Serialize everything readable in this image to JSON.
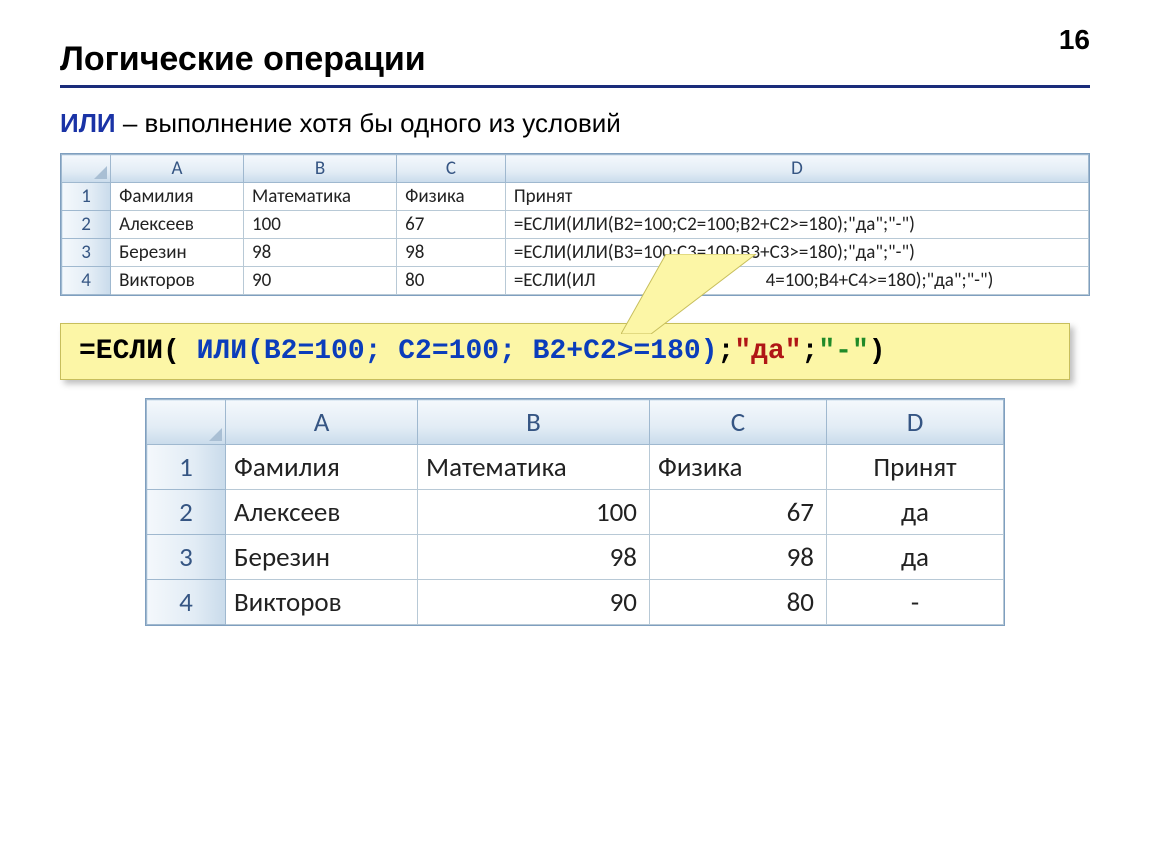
{
  "page_number": "16",
  "title": "Логические операции",
  "subtitle_keyword": "ИЛИ",
  "subtitle_rest": " – выполнение хотя бы одного из условий",
  "table1": {
    "col_headers": [
      "A",
      "B",
      "C",
      "D"
    ],
    "row_headers": [
      "1",
      "2",
      "3",
      "4"
    ],
    "rows": [
      {
        "a": "Фамилия",
        "b": "Математика",
        "c": "Физика",
        "d": "Принят"
      },
      {
        "a": "Алексеев",
        "b": "100",
        "c": "67",
        "d": "=ЕСЛИ(ИЛИ(B2=100;C2=100;B2+C2>=180);\"да\";\"-\")"
      },
      {
        "a": "Березин",
        "b": "98",
        "c": "98",
        "d": "=ЕСЛИ(ИЛИ(B3=100;C3=100;B3+C3>=180);\"да\";\"-\")"
      },
      {
        "a": "Викторов",
        "b": "90",
        "c": "80",
        "d_prefix": "=ЕСЛИ(ИЛ",
        "d_suffix": "4=100;B4+C4>=180);\"да\";\"-\")"
      }
    ]
  },
  "formula": {
    "prefix": "=ЕСЛИ( ",
    "or_part": "ИЛИ(B2=100; C2=100; B2+C2>=180)",
    "mid": ";",
    "yes": "\"да\"",
    "sep": ";",
    "no": "\"-\"",
    "suffix": ")"
  },
  "table2": {
    "col_headers": [
      "A",
      "B",
      "C",
      "D"
    ],
    "row_headers": [
      "1",
      "2",
      "3",
      "4"
    ],
    "rows": [
      {
        "a": "Фамилия",
        "b": "Математика",
        "c": "Физика",
        "d": "Принят"
      },
      {
        "a": "Алексеев",
        "b": "100",
        "c": "67",
        "d": "да"
      },
      {
        "a": "Березин",
        "b": "98",
        "c": "98",
        "d": "да"
      },
      {
        "a": "Викторов",
        "b": "90",
        "c": "80",
        "d": "-"
      }
    ]
  }
}
